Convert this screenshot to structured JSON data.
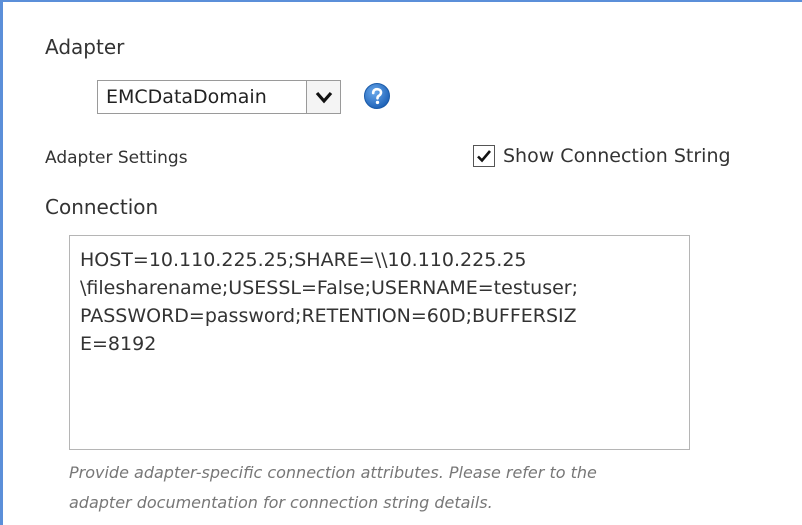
{
  "adapter": {
    "label": "Adapter",
    "selected": "EMCDataDomain"
  },
  "settings": {
    "label": "Adapter Settings",
    "show_connection_label": "Show Connection String",
    "show_connection_checked": true
  },
  "connection": {
    "label": "Connection",
    "value": "HOST=10.110.225.25;SHARE=\\\\10.110.225.25\n\\filesharename;USESSL=False;USERNAME=testuser;\nPASSWORD=password;RETENTION=60D;BUFFERSIZ\nE=8192",
    "help_line1": "Provide adapter-specific connection attributes. Please refer to the",
    "help_line2": "adapter documentation for connection string details."
  },
  "colors": {
    "accent_border": "#5b8fd9",
    "help_icon": "#2a73c9"
  },
  "icons": {
    "dropdown": "chevron-down-icon",
    "help": "question-circle-icon",
    "check": "checkmark-icon"
  }
}
